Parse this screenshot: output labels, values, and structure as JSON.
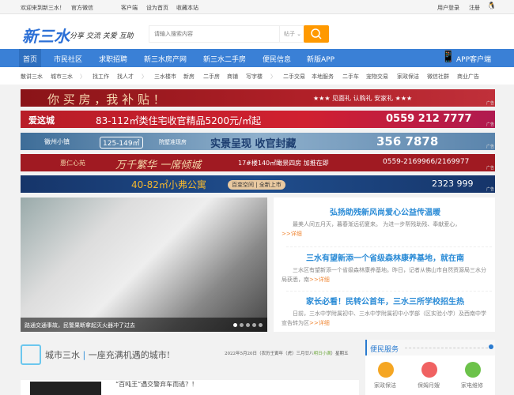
{
  "topbar": {
    "welcome": "欢迎来到新三水！",
    "wechat": "官方微信",
    "client": "客户端",
    "set_home": "设为首页",
    "bookmark": "收藏本站",
    "login": "用户登录",
    "register": "注册"
  },
  "header": {
    "logo": "新三水",
    "slogan": "分享 交流 关爱 互助",
    "search_placeholder": "请输入搜索内容",
    "search_type": "帖子"
  },
  "nav": {
    "items": [
      "首页",
      "市民社区",
      "求职招聘",
      "新三水房产网",
      "新三水二手房",
      "便民信息",
      "新版APP"
    ],
    "app": "APP客户端"
  },
  "subnav": [
    "散讲三水",
    "城市三水",
    "找工作",
    "找人才",
    "三水楼市",
    "新房",
    "二手房",
    "商铺",
    "写字楼",
    "二手交易",
    "本地服务",
    "二手车",
    "宠物交易",
    "家政保洁",
    "微信社群",
    "商业广告"
  ],
  "banners": [
    {
      "main": "你 买 房 ，我 补 贴 ！",
      "right": "★★★ 见面礼 认购礼 安家礼 ★★★",
      "bg": "#9e1a1f"
    },
    {
      "brand": "爱这城",
      "main": "83-112㎡类住宅收官精品5200元/㎡起",
      "right": "0559 212 7777",
      "bg": "#c0202a"
    },
    {
      "brand": "徽州小镇",
      "area": "125-149㎡",
      "sub": "院墅准现房",
      "main": "实景呈现 收官封藏",
      "right": "356 7878",
      "bg": "#5f88b0"
    },
    {
      "brand": "惠仁心苑",
      "main": "万千繁华 一席倾城",
      "sub": "17#楼140㎡瞰景四房 加推在即",
      "right": "0559-2169966/2169977",
      "bg": "#a01a22"
    },
    {
      "main": "40-82㎡小弗公寓",
      "sub": "百变空间 | 全新上市",
      "right": "2323 999",
      "bg": "#1c3f7a"
    }
  ],
  "ad_label": "广告",
  "slider": {
    "caption": "路通交通事故，民警果断拿起灭火器冲了过去"
  },
  "news": [
    {
      "title": "弘扬助残新风尚爱心公益传温暖",
      "summary": "最美人间五月天，暮春渐远初夏来。 为进一步帮残助残、奉献爱心，",
      "more": ">>详细"
    },
    {
      "title": "三水有望新添一个省级森林康养基地，就在南",
      "summary": "三水区有望新添一个省级森林康养基地。昨日，记者从佛山市自然资源局三水分局获悉，南",
      "more": ">>详细"
    },
    {
      "title": "家长必看！民转公首年，三水三所学校招生热",
      "summary": "日前，三水中学附属初中、三水中学附属初中小学部（区实验小学）及西南中学宣告转为区",
      "more": ">>详细"
    }
  ],
  "city": {
    "title": "城市三水",
    "tagline": "一座充满机遇的城市!",
    "date": "2022年5月20日（农历壬寅年（虎）三月廿八",
    "solar_term": "明日小满",
    "weekday": "）星期五"
  },
  "article": {
    "title": "“百吨王”遇交警弃车而逃？！"
  },
  "services": {
    "title": "便民服务",
    "items": [
      {
        "label": "家政保洁",
        "color": "#f5a623"
      },
      {
        "label": "保姆月嫂",
        "color": "#f06262"
      },
      {
        "label": "家电维修",
        "color": "#6cc24a"
      }
    ]
  }
}
